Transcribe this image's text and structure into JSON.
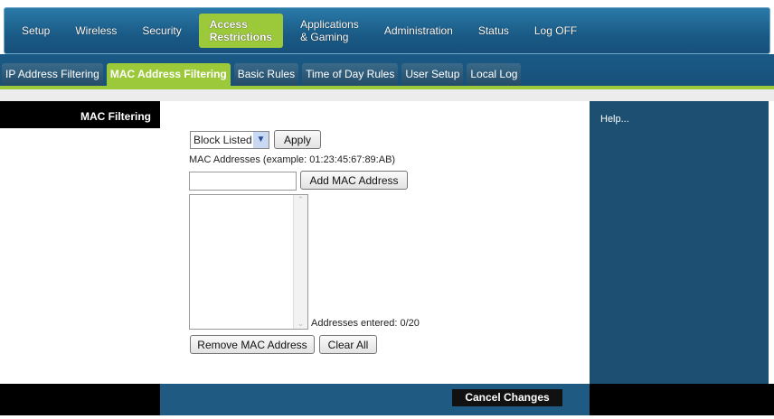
{
  "nav": {
    "items": [
      "Setup",
      "Wireless",
      "Security"
    ],
    "active": [
      "Access",
      "Restrictions"
    ],
    "apps": [
      "Applications",
      "& Gaming"
    ],
    "items2": [
      "Administration",
      "Status",
      "Log OFF"
    ]
  },
  "tabs": [
    "IP Address Filtering",
    "MAC Address Filtering",
    "Basic Rules",
    "Time of Day Rules",
    "User Setup",
    "Local Log"
  ],
  "left": {
    "heading": "MAC Filtering"
  },
  "help": {
    "label": "Help..."
  },
  "form": {
    "mode": "Block Listed",
    "apply": "Apply",
    "mac_label": "MAC Addresses (example: 01:23:45:67:89:AB)",
    "mac_value": "",
    "add": "Add MAC Address",
    "count": "Addresses entered: 0/20",
    "remove": "Remove MAC Address",
    "clear": "Clear All"
  },
  "footer": {
    "cancel": "Cancel Changes"
  }
}
